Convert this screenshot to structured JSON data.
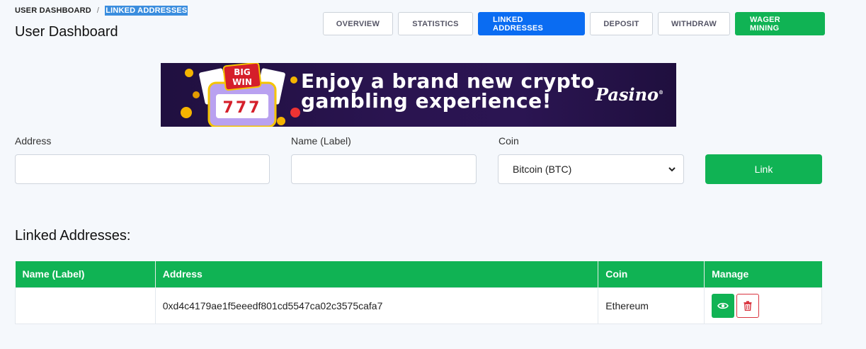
{
  "breadcrumb": {
    "root": "USER DASHBOARD",
    "separator": "/",
    "current": "LINKED ADDRESSES"
  },
  "page_title": "User Dashboard",
  "tabs": [
    {
      "label": "OVERVIEW",
      "active": false
    },
    {
      "label": "STATISTICS",
      "active": false
    },
    {
      "label": "LINKED ADDRESSES",
      "active": true
    },
    {
      "label": "DEPOSIT",
      "active": false
    },
    {
      "label": "WITHDRAW",
      "active": false
    },
    {
      "label": "WAGER MINING",
      "active": false
    }
  ],
  "banner": {
    "line1": "Enjoy a brand new crypto",
    "line2": "gambling experience!",
    "brand": "Pasino",
    "badge_big": "BIG",
    "badge_win": "WIN",
    "slot": "777"
  },
  "form": {
    "address_label": "Address",
    "address_value": "",
    "name_label": "Name (Label)",
    "name_value": "",
    "coin_label": "Coin",
    "coin_selected": "Bitcoin (BTC)",
    "link_button": "Link"
  },
  "linked": {
    "title": "Linked Addresses:",
    "columns": [
      "Name (Label)",
      "Address",
      "Coin",
      "Manage"
    ],
    "rows": [
      {
        "name": "",
        "address": "0xd4c4179ae1f5eeedf801cd5547ca02c3575cafa7",
        "coin": "Ethereum"
      }
    ]
  },
  "colors": {
    "accent_blue": "#0a6cf2",
    "accent_green": "#10b354",
    "danger": "#d9343f"
  },
  "icons": {
    "view": "eye-icon",
    "delete": "trash-icon",
    "select": "chevron-down-icon"
  }
}
